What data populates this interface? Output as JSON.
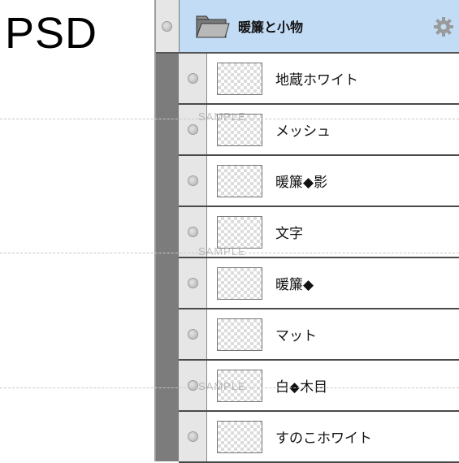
{
  "header": {
    "format_label": "PSD"
  },
  "group": {
    "name": "暖簾と小物",
    "icon": "folder-icon",
    "action_icon": "gear-icon"
  },
  "layers": [
    {
      "name": "地蔵ホワイト"
    },
    {
      "name": "メッシュ"
    },
    {
      "name": "暖簾◆影"
    },
    {
      "name": "文字"
    },
    {
      "name": "暖簾◆"
    },
    {
      "name": "マット"
    },
    {
      "name": "白◆木目"
    },
    {
      "name": "すのこホワイト"
    }
  ],
  "watermark": "SAMPLE",
  "colors": {
    "group_highlight": "#c3dcf6",
    "gutter": "#7c7c7c",
    "row_border": "#4a4a4a"
  }
}
